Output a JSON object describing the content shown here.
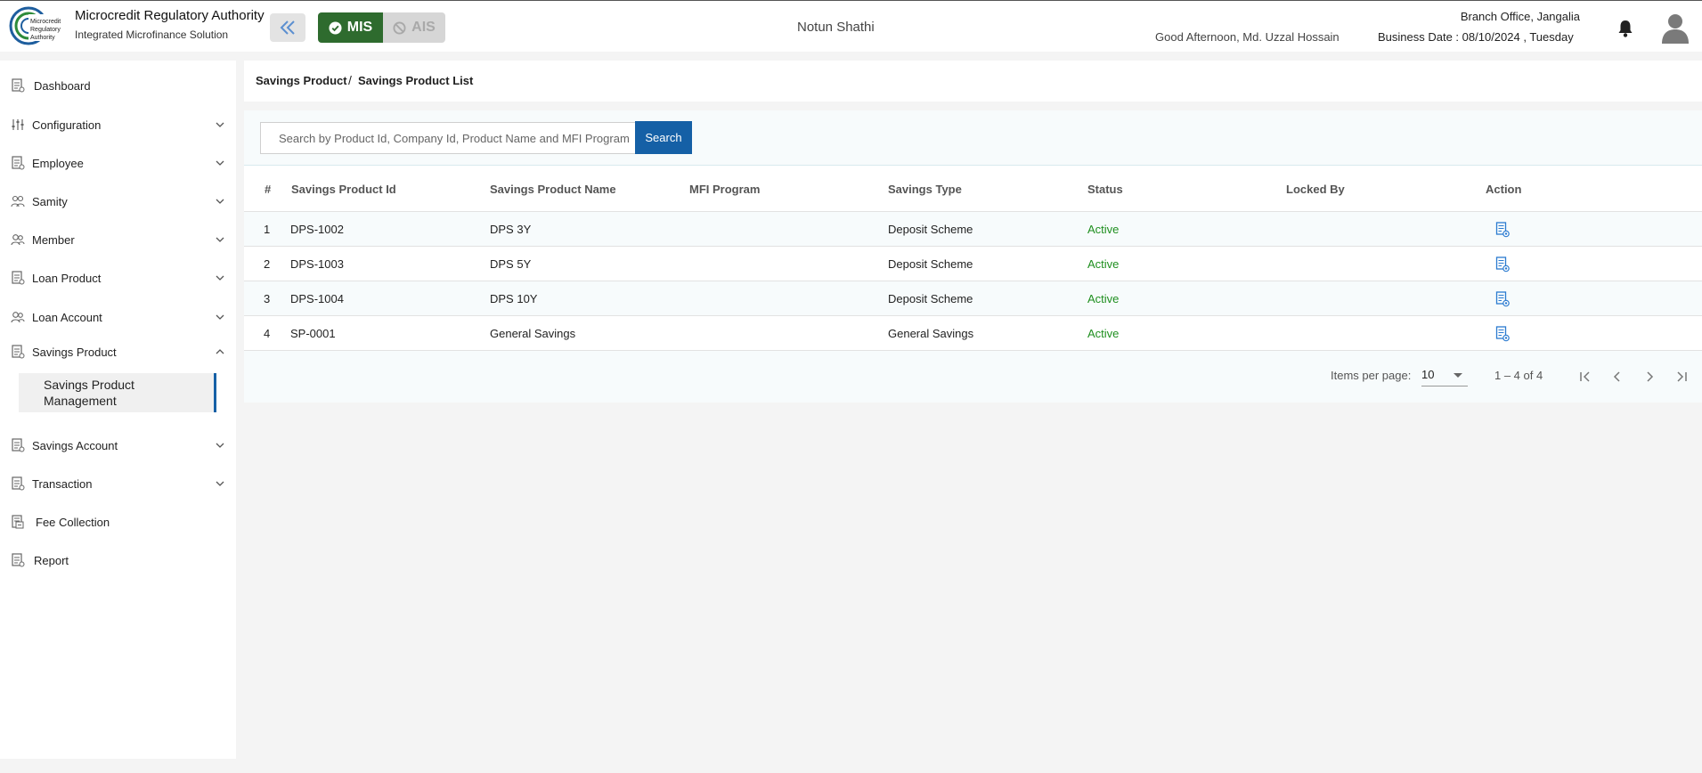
{
  "header": {
    "org_name": "Microcredit Regulatory Authority",
    "org_subtitle": "Integrated Microfinance Solution",
    "logo_text": "Microcredit Regulatory Authority",
    "mode_active": "MIS",
    "mode_inactive": "AIS",
    "center_title": "Notun Shathi",
    "branch": "Branch Office, Jangalia",
    "greeting": "Good Afternoon, Md. Uzzal Hossain",
    "business_date": "Business Date : 08/10/2024 , Tuesday"
  },
  "sidebar": {
    "items": [
      {
        "label": "Dashboard",
        "icon": "document-icon",
        "expandable": false
      },
      {
        "label": "Configuration",
        "icon": "sliders-icon",
        "expandable": true
      },
      {
        "label": "Employee",
        "icon": "document-icon",
        "expandable": true
      },
      {
        "label": "Samity",
        "icon": "group-icon",
        "expandable": true
      },
      {
        "label": "Member",
        "icon": "people-icon",
        "expandable": true
      },
      {
        "label": "Loan Product",
        "icon": "document-icon",
        "expandable": true
      },
      {
        "label": "Loan Account",
        "icon": "people-icon",
        "expandable": true
      },
      {
        "label": "Savings Product",
        "icon": "document-icon",
        "expandable": true,
        "expanded": true
      },
      {
        "label": "Savings Account",
        "icon": "document-icon",
        "expandable": true
      },
      {
        "label": "Transaction",
        "icon": "document-icon",
        "expandable": true
      },
      {
        "label": "Fee Collection",
        "icon": "fee-icon",
        "expandable": false
      },
      {
        "label": "Report",
        "icon": "document-icon",
        "expandable": false
      }
    ],
    "active_sub_item": "Savings Product Management"
  },
  "breadcrumb": {
    "parent": "Savings Product",
    "separator": "/",
    "current": "Savings Product List"
  },
  "search": {
    "placeholder": "Search by Product Id, Company Id, Product Name and MFI Program",
    "value": "",
    "button_label": "Search"
  },
  "table": {
    "columns": [
      "#",
      "Savings Product Id",
      "Savings Product Name",
      "MFI Program",
      "Savings Type",
      "Status",
      "Locked By",
      "Action"
    ],
    "rows": [
      {
        "no": "1",
        "id": "DPS-1002",
        "name": "DPS 3Y",
        "mfi": "",
        "type": "Deposit Scheme",
        "status": "Active",
        "locked_by": ""
      },
      {
        "no": "2",
        "id": "DPS-1003",
        "name": "DPS 5Y",
        "mfi": "",
        "type": "Deposit Scheme",
        "status": "Active",
        "locked_by": ""
      },
      {
        "no": "3",
        "id": "DPS-1004",
        "name": "DPS 10Y",
        "mfi": "",
        "type": "Deposit Scheme",
        "status": "Active",
        "locked_by": ""
      },
      {
        "no": "4",
        "id": "SP-0001",
        "name": "General Savings",
        "mfi": "",
        "type": "General Savings",
        "status": "Active",
        "locked_by": ""
      }
    ]
  },
  "pagination": {
    "items_per_page_label": "Items per page:",
    "items_per_page": "10",
    "range": "1 – 4 of 4"
  },
  "colors": {
    "primary": "#1560a6",
    "mis_active": "#2e6b2e",
    "status_active": "#1f8f1f",
    "icon_blue": "#2b7bd0"
  }
}
